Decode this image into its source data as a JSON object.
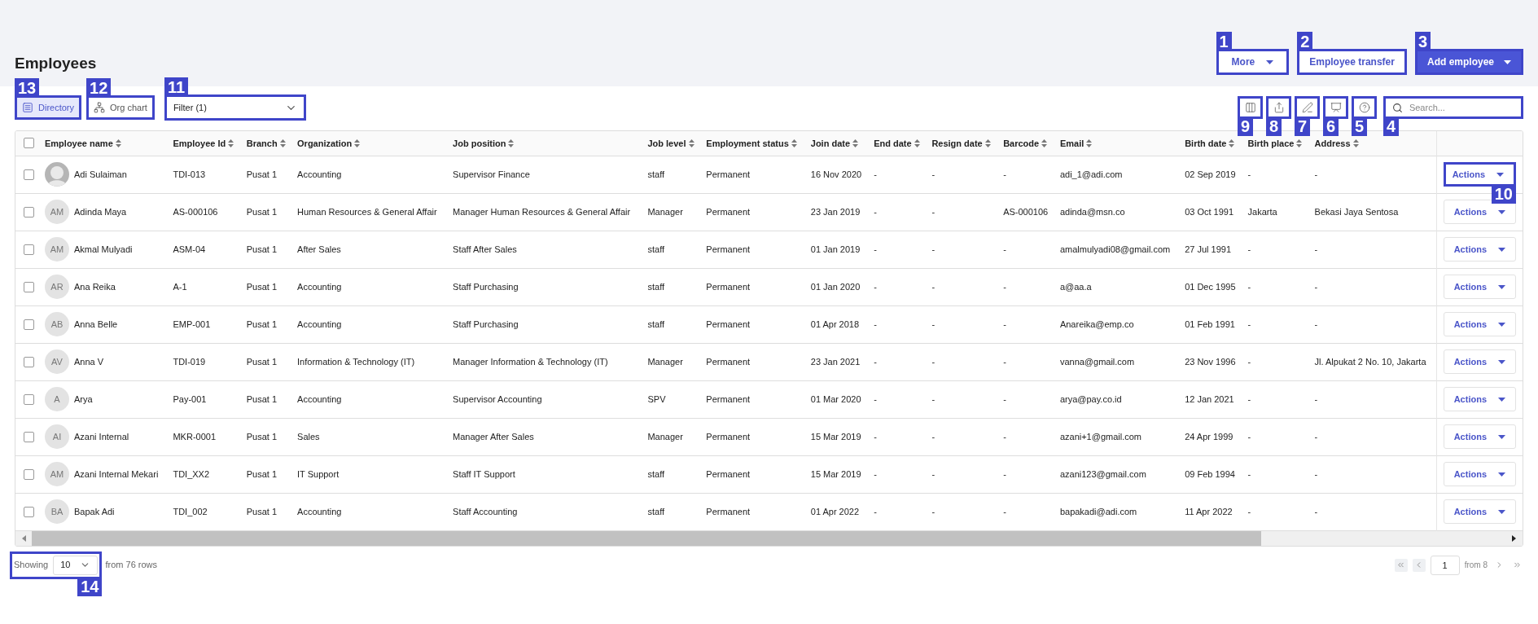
{
  "page": {
    "title": "Employees"
  },
  "header_buttons": [
    {
      "kind": "dropdown",
      "label": "More",
      "annotation": "1"
    },
    {
      "kind": "outline",
      "label": "Employee transfer",
      "annotation": "2"
    },
    {
      "kind": "primary",
      "label": "Add employee",
      "annotation": "3"
    }
  ],
  "view_tabs": [
    {
      "kind": "directory",
      "label": "Directory",
      "selected": true,
      "annotation": "13"
    },
    {
      "kind": "org",
      "label": "Org chart",
      "selected": false,
      "annotation": "12"
    }
  ],
  "filter": {
    "value": "Filter (1)",
    "annotation": "11"
  },
  "tools": [
    {
      "kind": "columns",
      "annotation": "9"
    },
    {
      "kind": "export",
      "annotation": "8"
    },
    {
      "kind": "edit",
      "annotation": "7"
    },
    {
      "kind": "monitor",
      "annotation": "6"
    },
    {
      "kind": "help",
      "annotation": "5"
    }
  ],
  "search": {
    "placeholder": "Search...",
    "annotation": "4"
  },
  "table": {
    "columns": [
      "Employee name",
      "Employee Id",
      "Branch",
      "Organization",
      "Job position",
      "Job level",
      "Employment status",
      "Join date",
      "End date",
      "Resign date",
      "Barcode",
      "Email",
      "Birth date",
      "Birth place",
      "Address"
    ],
    "select_all": {
      "checked": false
    },
    "rows": [
      {
        "checked": false,
        "avatar": {
          "kind": "photo"
        },
        "cells": [
          "Adi Sulaiman",
          "TDI-013",
          "Pusat 1",
          "Accounting",
          "Supervisor Finance",
          "staff",
          "Permanent",
          "16 Nov 2020",
          "-",
          "-",
          "-",
          "adi_1@adi.com",
          "02 Sep 2019",
          "-",
          "-"
        ],
        "action": "Actions",
        "annotation": "10"
      },
      {
        "checked": false,
        "avatar": {
          "kind": "initials",
          "text": "AM"
        },
        "cells": [
          "Adinda Maya",
          "AS-000106",
          "Pusat 1",
          "Human Resources & General Affair",
          "Manager Human Resources & General Affair",
          "Manager",
          "Permanent",
          "23 Jan 2019",
          "-",
          "-",
          "AS-000106",
          "adinda@msn.co",
          "03 Oct 1991",
          "Jakarta",
          "Bekasi Jaya Sentosa"
        ],
        "action": "Actions"
      },
      {
        "checked": false,
        "avatar": {
          "kind": "initials",
          "text": "AM"
        },
        "cells": [
          "Akmal Mulyadi",
          "ASM-04",
          "Pusat 1",
          "After Sales",
          "Staff After Sales",
          "staff",
          "Permanent",
          "01 Jan 2019",
          "-",
          "-",
          "-",
          "amalmulyadi08@gmail.com",
          "27 Jul 1991",
          "-",
          "-"
        ],
        "action": "Actions"
      },
      {
        "checked": false,
        "avatar": {
          "kind": "initials",
          "text": "AR"
        },
        "cells": [
          "Ana Reika",
          "A-1",
          "Pusat 1",
          "Accounting",
          "Staff Purchasing",
          "staff",
          "Permanent",
          "01 Jan 2020",
          "-",
          "-",
          "-",
          "a@aa.a",
          "01 Dec 1995",
          "-",
          "-"
        ],
        "action": "Actions"
      },
      {
        "checked": false,
        "avatar": {
          "kind": "initials",
          "text": "AB"
        },
        "cells": [
          "Anna Belle",
          "EMP-001",
          "Pusat 1",
          "Accounting",
          "Staff Purchasing",
          "staff",
          "Permanent",
          "01 Apr 2018",
          "-",
          "-",
          "-",
          "Anareika@emp.co",
          "01 Feb 1991",
          "-",
          "-"
        ],
        "action": "Actions"
      },
      {
        "checked": false,
        "avatar": {
          "kind": "initials",
          "text": "AV"
        },
        "cells": [
          "Anna V",
          "TDI-019",
          "Pusat 1",
          "Information & Technology (IT)",
          "Manager Information & Technology (IT)",
          "Manager",
          "Permanent",
          "23 Jan 2021",
          "-",
          "-",
          "-",
          "vanna@gmail.com",
          "23 Nov 1996",
          "-",
          "Jl. Alpukat 2 No. 10, Jakarta"
        ],
        "action": "Actions"
      },
      {
        "checked": false,
        "avatar": {
          "kind": "initials",
          "text": "A"
        },
        "cells": [
          "Arya",
          "Pay-001",
          "Pusat 1",
          "Accounting",
          "Supervisor Accounting",
          "SPV",
          "Permanent",
          "01 Mar 2020",
          "-",
          "-",
          "-",
          "arya@pay.co.id",
          "12 Jan 2021",
          "-",
          "-"
        ],
        "action": "Actions"
      },
      {
        "checked": false,
        "avatar": {
          "kind": "initials",
          "text": "AI"
        },
        "cells": [
          "Azani Internal",
          "MKR-0001",
          "Pusat 1",
          "Sales",
          "Manager After Sales",
          "Manager",
          "Permanent",
          "15 Mar 2019",
          "-",
          "-",
          "-",
          "azani+1@gmail.com",
          "24 Apr 1999",
          "-",
          "-"
        ],
        "action": "Actions"
      },
      {
        "checked": false,
        "avatar": {
          "kind": "initials",
          "text": "AM"
        },
        "cells": [
          "Azani Internal Mekari",
          "TDI_XX2",
          "Pusat 1",
          "IT Support",
          "Staff IT Support",
          "staff",
          "Permanent",
          "15 Mar 2019",
          "-",
          "-",
          "-",
          "azani123@gmail.com",
          "09 Feb 1994",
          "-",
          "-"
        ],
        "action": "Actions"
      },
      {
        "checked": false,
        "avatar": {
          "kind": "initials",
          "text": "BA"
        },
        "cells": [
          "Bapak Adi",
          "TDI_002",
          "Pusat 1",
          "Accounting",
          "Staff Accounting",
          "staff",
          "Permanent",
          "01 Apr 2022",
          "-",
          "-",
          "-",
          "bapakadi@adi.com",
          "11 Apr 2022",
          "-",
          "-"
        ],
        "action": "Actions"
      }
    ]
  },
  "footer": {
    "showing": "Showing",
    "page_size": "10",
    "total": "from 76 rows",
    "annotation": "14",
    "page": "1",
    "page_total": "from 8"
  }
}
